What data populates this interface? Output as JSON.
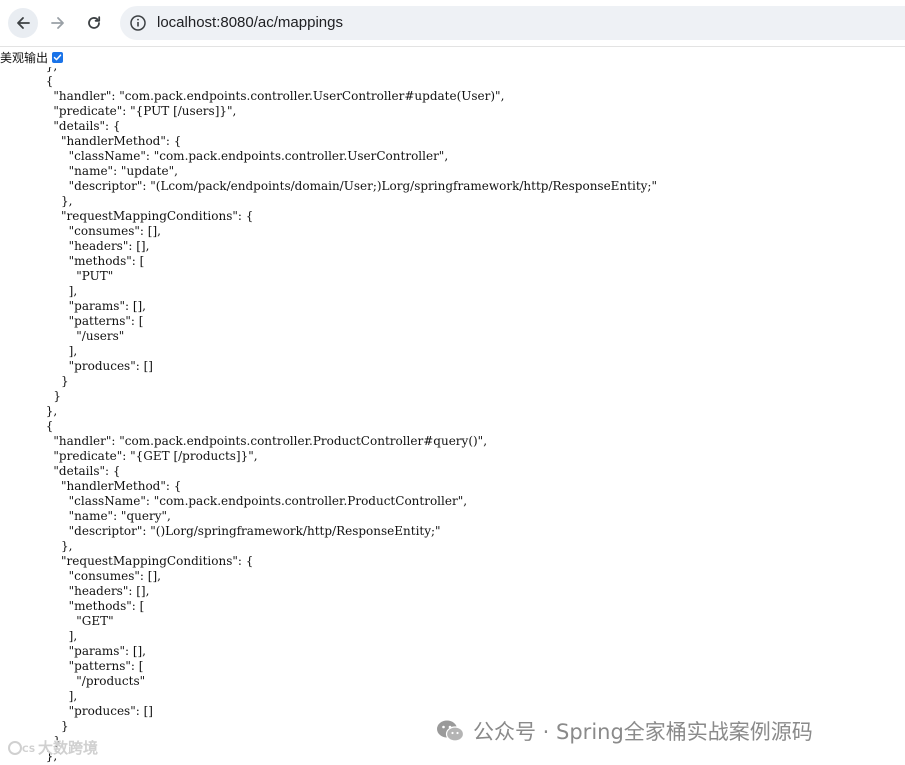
{
  "browser": {
    "url": "localhost:8080/ac/mappings"
  },
  "toolbar": {
    "pretty_print_label": "美观输出",
    "pretty_print_checked": true
  },
  "json_lines": [
    "},",
    "{",
    "  \"handler\": \"com.pack.endpoints.controller.UserController#update(User)\",",
    "  \"predicate\": \"{PUT [/users]}\",",
    "  \"details\": {",
    "    \"handlerMethod\": {",
    "      \"className\": \"com.pack.endpoints.controller.UserController\",",
    "      \"name\": \"update\",",
    "      \"descriptor\": \"(Lcom/pack/endpoints/domain/User;)Lorg/springframework/http/ResponseEntity;\"",
    "    },",
    "    \"requestMappingConditions\": {",
    "      \"consumes\": [],",
    "      \"headers\": [],",
    "      \"methods\": [",
    "        \"PUT\"",
    "      ],",
    "      \"params\": [],",
    "      \"patterns\": [",
    "        \"/users\"",
    "      ],",
    "      \"produces\": []",
    "    }",
    "  }",
    "},",
    "{",
    "  \"handler\": \"com.pack.endpoints.controller.ProductController#query()\",",
    "  \"predicate\": \"{GET [/products]}\",",
    "  \"details\": {",
    "    \"handlerMethod\": {",
    "      \"className\": \"com.pack.endpoints.controller.ProductController\",",
    "      \"name\": \"query\",",
    "      \"descriptor\": \"()Lorg/springframework/http/ResponseEntity;\"",
    "    },",
    "    \"requestMappingConditions\": {",
    "      \"consumes\": [],",
    "      \"headers\": [],",
    "      \"methods\": [",
    "        \"GET\"",
    "      ],",
    "      \"params\": [],",
    "      \"patterns\": [",
    "        \"/products\"",
    "      ],",
    "      \"produces\": []",
    "    }",
    "  }",
    "},"
  ],
  "watermark": {
    "text": "公众号 · Spring全家桶实战案例源码",
    "corner_text": "大数跨境"
  }
}
